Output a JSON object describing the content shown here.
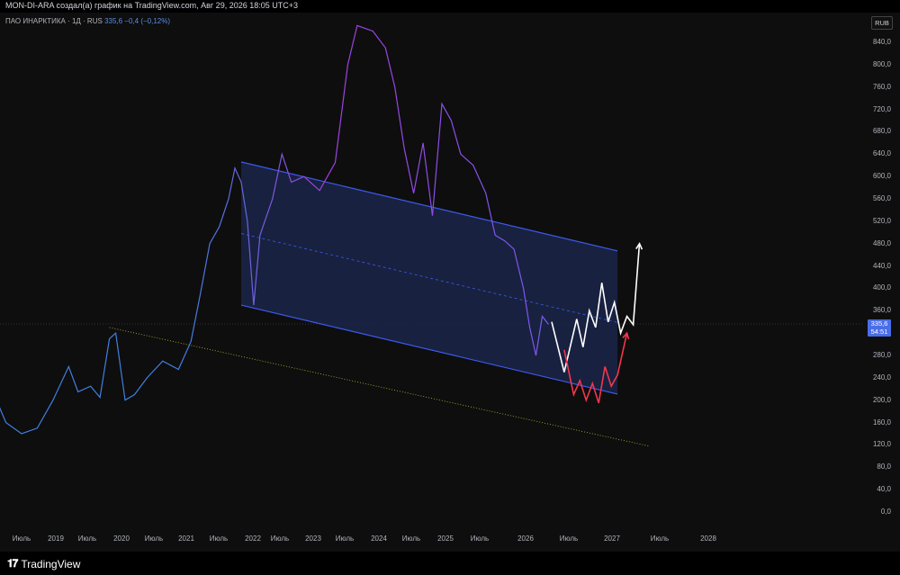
{
  "header": {
    "caption": "MON-DI-ARA создал(а) график на TradingView.com, Авг 29, 2026 18:05 UTC+3"
  },
  "legend": {
    "symbol": "ПАО ИНАРКТИКА · 1Д · RUS",
    "values": "335,6  −0,4 (−0,12%)"
  },
  "currency": "RUB",
  "price_tag": {
    "price": "335,6",
    "countdown": "54:51"
  },
  "footer": {
    "brand": "TradingView"
  },
  "colors": {
    "price_line_early": "#3f7fe0",
    "price_line_late": "#a040e0",
    "channel": "#3d5af1",
    "channel_fill": "#1a2448",
    "projection_up": "#ffffff",
    "projection_down": "#f2364d",
    "trendline": "#b5b53a"
  },
  "chart_data": {
    "type": "line",
    "title": "",
    "y_ticks": [
      "840,0",
      "800,0",
      "760,0",
      "720,0",
      "680,0",
      "640,0",
      "600,0",
      "560,0",
      "520,0",
      "480,0",
      "440,0",
      "400,0",
      "360,0",
      "320,0",
      "280,0",
      "240,0",
      "200,0",
      "160,0",
      "120,0",
      "80,0",
      "40,0",
      "0,0"
    ],
    "x_ticks": [
      "Июль",
      "2019",
      "Июль",
      "2020",
      "Июль",
      "2021",
      "Июль",
      "2022",
      "Июль",
      "2023",
      "Июль",
      "2024",
      "Июль",
      "2025",
      "Июль",
      "2026",
      "Июль",
      "2027",
      "Июль",
      "2028"
    ],
    "ylim": [
      0,
      880
    ],
    "series": [
      {
        "values": [
          [
            2018.0,
            170
          ],
          [
            2018.1,
            200
          ],
          [
            2018.25,
            160
          ],
          [
            2018.5,
            140
          ],
          [
            2018.75,
            150
          ],
          [
            2019.0,
            200
          ],
          [
            2019.25,
            260
          ],
          [
            2019.4,
            215
          ],
          [
            2019.6,
            225
          ],
          [
            2019.75,
            205
          ],
          [
            2019.9,
            310
          ],
          [
            2020.0,
            320
          ],
          [
            2020.15,
            200
          ],
          [
            2020.3,
            210
          ],
          [
            2020.5,
            240
          ],
          [
            2020.75,
            270
          ],
          [
            2021.0,
            255
          ],
          [
            2021.2,
            305
          ],
          [
            2021.35,
            390
          ],
          [
            2021.5,
            480
          ],
          [
            2021.65,
            510
          ],
          [
            2021.8,
            560
          ],
          [
            2021.9,
            615
          ],
          [
            2022.0,
            590
          ],
          [
            2022.1,
            520
          ],
          [
            2022.2,
            370
          ],
          [
            2022.3,
            495
          ],
          [
            2022.5,
            560
          ],
          [
            2022.65,
            640
          ],
          [
            2022.8,
            590
          ],
          [
            2023.0,
            600
          ],
          [
            2023.25,
            575
          ],
          [
            2023.5,
            625
          ],
          [
            2023.7,
            800
          ],
          [
            2023.85,
            870
          ],
          [
            2024.1,
            860
          ],
          [
            2024.3,
            830
          ],
          [
            2024.45,
            760
          ],
          [
            2024.6,
            650
          ],
          [
            2024.75,
            570
          ],
          [
            2024.9,
            660
          ],
          [
            2025.05,
            530
          ],
          [
            2025.2,
            730
          ],
          [
            2025.35,
            700
          ],
          [
            2025.5,
            640
          ],
          [
            2025.7,
            620
          ],
          [
            2025.9,
            570
          ],
          [
            2026.05,
            495
          ],
          [
            2026.2,
            485
          ],
          [
            2026.35,
            470
          ],
          [
            2026.5,
            400
          ],
          [
            2026.6,
            330
          ],
          [
            2026.7,
            280
          ],
          [
            2026.8,
            350
          ],
          [
            2026.9,
            335.6
          ]
        ]
      }
    ],
    "annotations": {
      "channel": {
        "upper": [
          [
            2022.0,
            626
          ],
          [
            2028.0,
            467
          ]
        ],
        "lower": [
          [
            2022.0,
            370
          ],
          [
            2028.0,
            211
          ]
        ]
      },
      "trendline": [
        [
          2019.9,
          330
        ],
        [
          2028.5,
          118
        ]
      ],
      "projection_up": [
        [
          2026.95,
          340
        ],
        [
          2027.15,
          250
        ],
        [
          2027.35,
          345
        ],
        [
          2027.45,
          295
        ],
        [
          2027.55,
          360
        ],
        [
          2027.65,
          330
        ],
        [
          2027.75,
          410
        ],
        [
          2027.85,
          340
        ],
        [
          2027.95,
          375
        ],
        [
          2028.05,
          320
        ],
        [
          2028.15,
          350
        ],
        [
          2028.25,
          335
        ],
        [
          2028.35,
          480
        ]
      ],
      "projection_down": [
        [
          2027.15,
          290
        ],
        [
          2027.3,
          210
        ],
        [
          2027.4,
          235
        ],
        [
          2027.5,
          200
        ],
        [
          2027.6,
          230
        ],
        [
          2027.7,
          195
        ],
        [
          2027.8,
          260
        ],
        [
          2027.9,
          225
        ],
        [
          2028.0,
          245
        ],
        [
          2028.15,
          320
        ]
      ],
      "current_price": 335.6
    }
  }
}
